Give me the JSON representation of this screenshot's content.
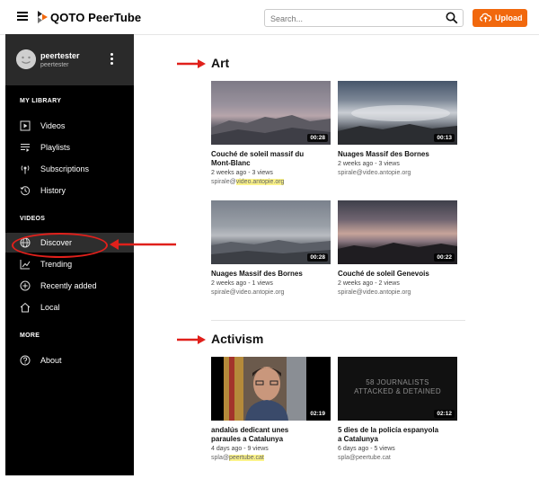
{
  "app": {
    "brand": "QOTO PeerTube"
  },
  "search": {
    "placeholder": "Search..."
  },
  "upload": {
    "label": "Upload"
  },
  "user": {
    "name": "peertester",
    "handle": "peertester"
  },
  "sidebar": {
    "my_library": {
      "heading": "MY LIBRARY",
      "items": [
        {
          "label": "Videos",
          "icon": "video-icon"
        },
        {
          "label": "Playlists",
          "icon": "playlist-icon"
        },
        {
          "label": "Subscriptions",
          "icon": "subscriptions-icon"
        },
        {
          "label": "History",
          "icon": "history-icon"
        }
      ]
    },
    "videos": {
      "heading": "VIDEOS",
      "items": [
        {
          "label": "Discover",
          "icon": "globe-icon",
          "active": true
        },
        {
          "label": "Trending",
          "icon": "trending-icon"
        },
        {
          "label": "Recently added",
          "icon": "plus-circle-icon"
        },
        {
          "label": "Local",
          "icon": "home-icon"
        }
      ]
    },
    "more": {
      "heading": "MORE",
      "items": [
        {
          "label": "About",
          "icon": "help-icon"
        }
      ]
    }
  },
  "sections": [
    {
      "title": "Art",
      "videos": [
        {
          "title_l1": "Couché de soleil massif du",
          "title_l2": "Mont-Blanc",
          "meta": "2 weeks ago - 3 views",
          "acct_user": "spirale@",
          "acct_host": "video.antopie.org",
          "duration": "00:28"
        },
        {
          "title_l1": "Nuages Massif des Bornes",
          "title_l2": "",
          "meta": "2 weeks ago - 3 views",
          "acct_user": "spirale@",
          "acct_host": "video.antopie.org",
          "duration": "00:13"
        },
        {
          "title_l1": "Nuages Massif des Bornes",
          "title_l2": "",
          "meta": "2 weeks ago - 1 views",
          "acct_user": "spirale@",
          "acct_host": "video.antopie.org",
          "duration": "00:28"
        },
        {
          "title_l1": "Couché de soleil Genevois",
          "title_l2": "",
          "meta": "2 weeks ago - 2 views",
          "acct_user": "spirale@",
          "acct_host": "video.antopie.org",
          "duration": "00:22"
        }
      ]
    },
    {
      "title": "Activism",
      "videos": [
        {
          "title_l1": "andalús dedicant unes",
          "title_l2": "paraules a Catalunya",
          "meta": "4 days ago - 9 views",
          "acct_user": "spla@",
          "acct_host": "peertube.cat",
          "duration": "02:19"
        },
        {
          "title_l1": "5 dies de la policía espanyola",
          "title_l2": "a Catalunya",
          "meta": "6 days ago - 5 views",
          "acct_user": "spla@",
          "acct_host": "peertube.cat",
          "duration": "02:12",
          "thumb_text_l1": "58 JOURNALISTS",
          "thumb_text_l2": "ATTACKED & DETAINED"
        }
      ]
    }
  ],
  "colors": {
    "accent": "#f1680d",
    "highlight_ring": "#e0201b",
    "sidebar_bg": "#000000",
    "text_highlight": "#fbf38a"
  }
}
